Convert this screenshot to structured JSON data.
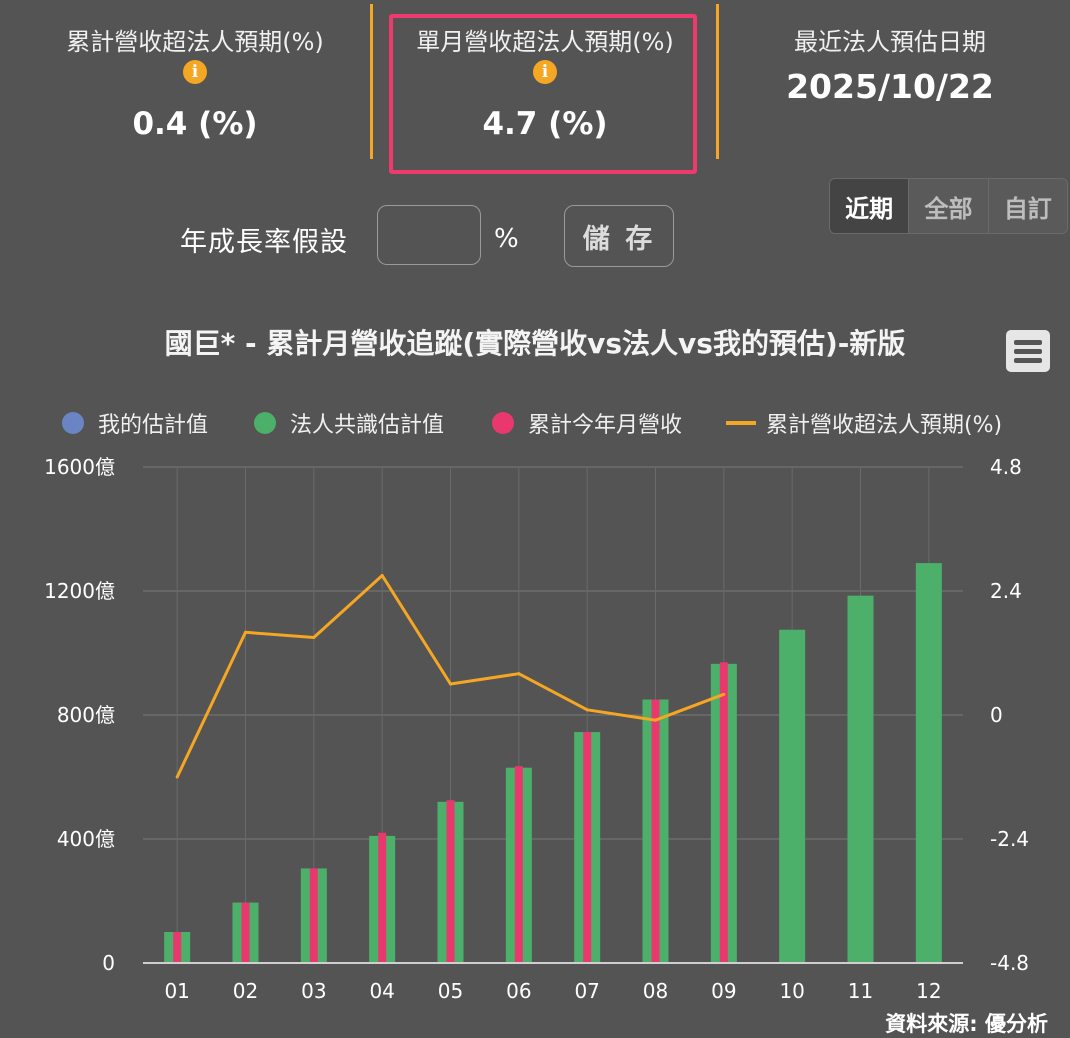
{
  "stats": {
    "cumulative": {
      "label": "累計營收超法人預期(%)",
      "value": "0.4 (%)"
    },
    "monthly": {
      "label": "單月營收超法人預期(%)",
      "value": "4.7 (%)"
    },
    "latest_date": {
      "label": "最近法人預估日期",
      "value": "2025/10/22"
    },
    "info_glyph": "i"
  },
  "range_tabs": [
    {
      "label": "近期",
      "active": true
    },
    {
      "label": "全部",
      "active": false
    },
    {
      "label": "自訂",
      "active": false
    }
  ],
  "growth": {
    "label": "年成長率假設",
    "unit": "%",
    "value": "",
    "save_label": "儲 存"
  },
  "colors": {
    "my_estimate": "#6b85c4",
    "consensus": "#4caf6a",
    "actual": "#e8386e",
    "line": "#f5a623",
    "highlight": "#f03a6e"
  },
  "chart_data": {
    "type": "bar",
    "title": "國巨* - 累計月營收追蹤(實際營收vs法人vs我的預估)-新版",
    "categories": [
      "01",
      "02",
      "03",
      "04",
      "05",
      "06",
      "07",
      "08",
      "09",
      "10",
      "11",
      "12"
    ],
    "series": [
      {
        "name": "我的估計值",
        "kind": "scatter",
        "values": []
      },
      {
        "name": "法人共識估計值",
        "kind": "bar",
        "values": [
          100,
          195,
          305,
          410,
          520,
          630,
          745,
          850,
          965,
          1075,
          1185,
          1290
        ]
      },
      {
        "name": "累計今年月營收",
        "kind": "bar",
        "values": [
          100,
          195,
          305,
          420,
          525,
          635,
          745,
          850,
          970,
          null,
          null,
          null
        ]
      },
      {
        "name": "累計營收超法人預期(%)",
        "kind": "line",
        "axis": "right",
        "values": [
          -1.2,
          1.6,
          1.5,
          2.7,
          0.6,
          0.8,
          0.1,
          -0.1,
          0.4,
          null,
          null,
          null
        ]
      }
    ],
    "y_left": {
      "ticks": [
        "0",
        "400億",
        "800億",
        "1200億",
        "1600億"
      ],
      "range": [
        0,
        1600
      ]
    },
    "y_right": {
      "ticks": [
        "-4.8",
        "-2.4",
        "0",
        "2.4",
        "4.8"
      ],
      "range": [
        -4.8,
        4.8
      ]
    },
    "grid": true,
    "legend_position": "top"
  },
  "source": "資料來源: 優分析"
}
